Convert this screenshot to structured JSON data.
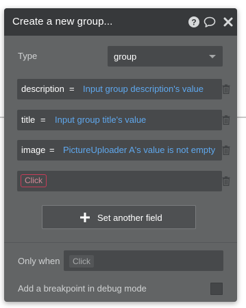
{
  "dialog": {
    "title": "Create a new group...",
    "icons": {
      "help": "help-icon",
      "comment": "comment-icon",
      "close": "close-icon"
    }
  },
  "type_field": {
    "label": "Type",
    "value": "group"
  },
  "fields": [
    {
      "name": "description",
      "eq": "=",
      "value": "Input group description's value"
    },
    {
      "name": "title",
      "eq": "=",
      "value": "Input group title's value"
    },
    {
      "name": "image",
      "eq": "=",
      "value": "PictureUploader A's value is not empty"
    }
  ],
  "new_field": {
    "placeholder": "Click"
  },
  "set_another_field": {
    "label": "Set another field"
  },
  "only_when": {
    "label": "Only when",
    "placeholder": "Click"
  },
  "debug": {
    "label": "Add a breakpoint in debug mode",
    "checked": false
  },
  "colors": {
    "panel_bg": "#626465",
    "header_bg": "#37393b",
    "field_bg": "#47494b",
    "value_blue": "#5fa8ee",
    "chip_border": "#c93b58"
  }
}
